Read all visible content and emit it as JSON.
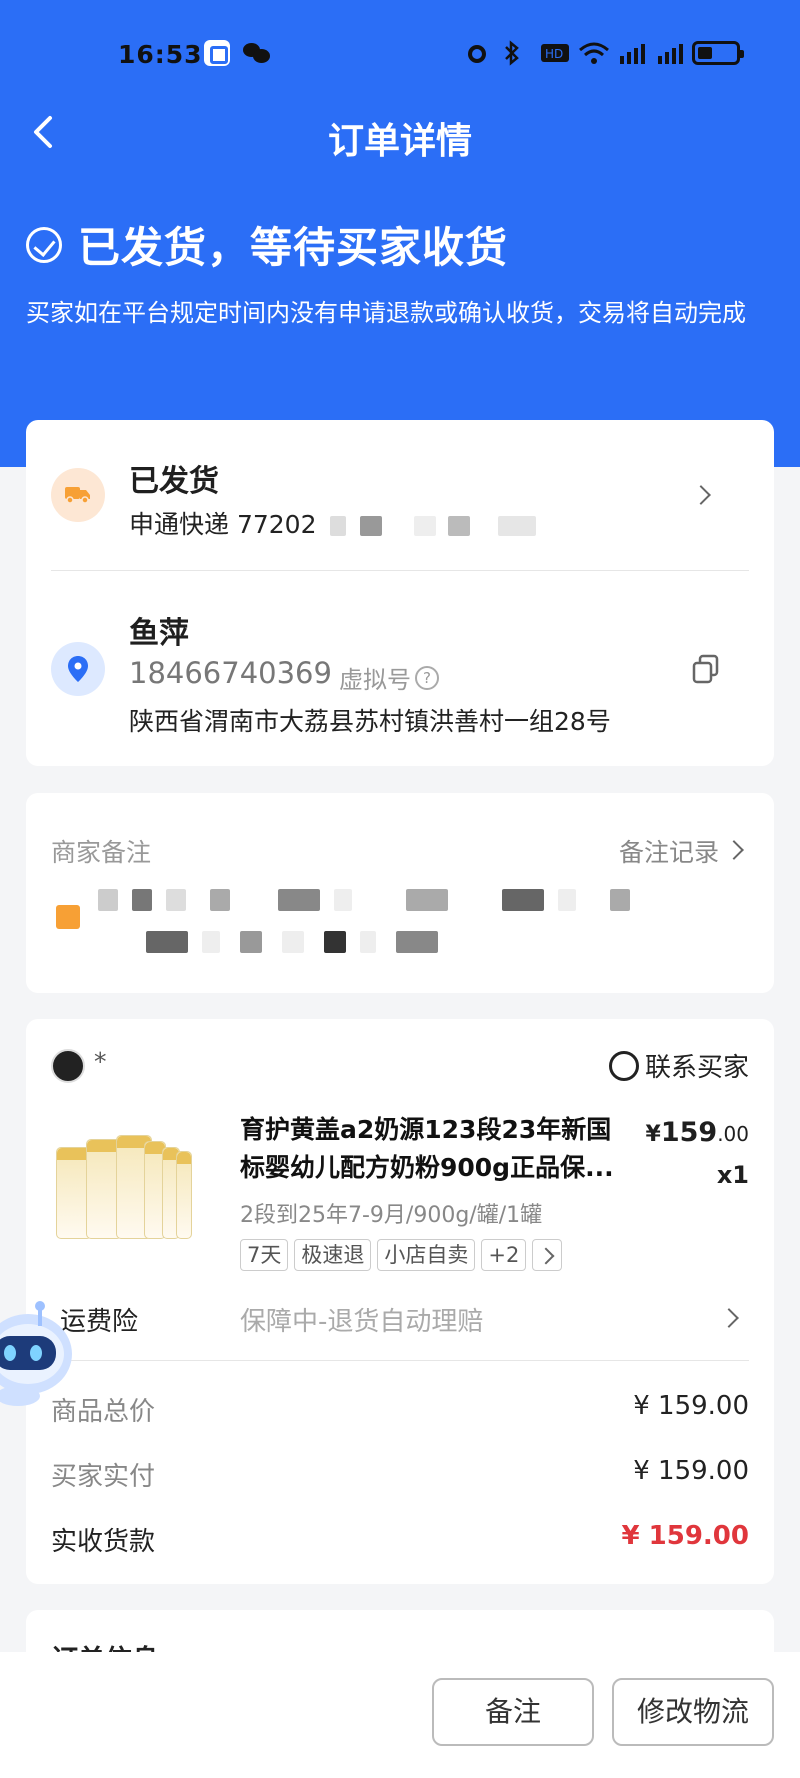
{
  "status_bar": {
    "time": "16:53"
  },
  "nav": {
    "title": "订单详情"
  },
  "order_status": {
    "title": "已发货，等待买家收货",
    "description": "买家如在平台规定时间内没有申请退款或确认收货，交易将自动完成"
  },
  "shipping": {
    "title": "已发货",
    "carrier_no": "申通快递 77202"
  },
  "address": {
    "name": "鱼萍",
    "phone": "18466740369",
    "virtual_label": "虚拟号",
    "full": "陕西省渭南市大荔县苏村镇洪善村一组28号"
  },
  "remark": {
    "label": "商家备注",
    "record_link": "备注记录"
  },
  "buyer": {
    "name": "*",
    "contact": "联系买家"
  },
  "product": {
    "title": "育护黄盖a2奶源123段23年新国标婴幼儿配方奶粉900g正品保...",
    "price_symbol": "¥",
    "price_int": "159",
    "price_dec": ".00",
    "qty": "x1",
    "spec": "2段到25年7-9月/900g/罐/1罐",
    "tags": [
      "7天",
      "极速退",
      "小店自卖",
      "+2"
    ]
  },
  "insurance": {
    "label": "运费险",
    "value": "保障中-退货自动理赔"
  },
  "summary": {
    "goods_total_label": "商品总价",
    "goods_total": "¥ 159.00",
    "buyer_paid_label": "买家实付",
    "buyer_paid": "¥ 159.00",
    "received_label": "实收货款",
    "received": "¥ 159.00",
    "received_color": "#e0363c"
  },
  "order_info": {
    "label": "订单信息"
  },
  "actions": {
    "remark_button": "备注",
    "logistics_button": "修改物流"
  },
  "colors": {
    "primary": "#2b6ef6",
    "accent_red": "#e0363c"
  }
}
